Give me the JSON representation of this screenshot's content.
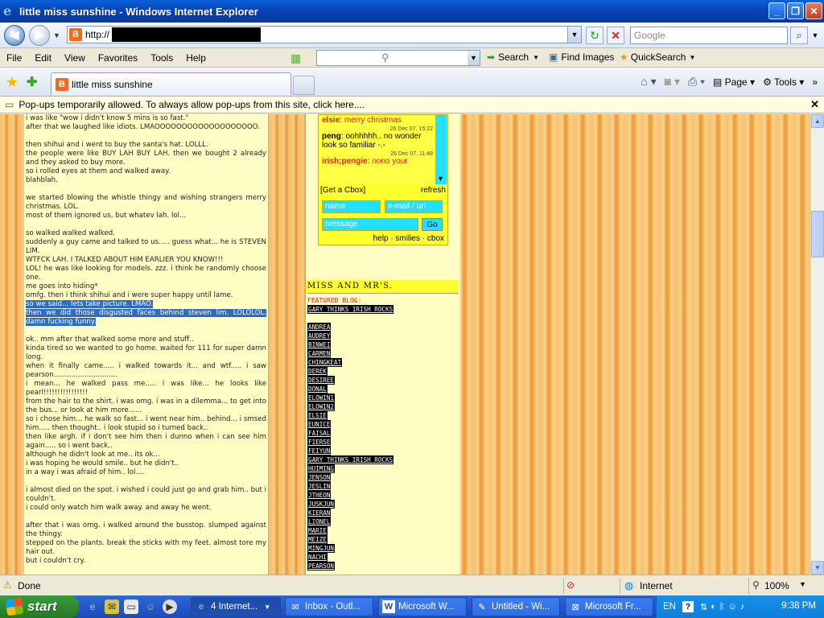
{
  "window": {
    "title": "little miss sunshine - Windows Internet Explorer"
  },
  "address": {
    "url_prefix": "http://",
    "search_placeholder": "Google"
  },
  "menu": {
    "items": [
      "File",
      "Edit",
      "View",
      "Favorites",
      "Tools",
      "Help"
    ],
    "search_label": "Search",
    "find_images_label": "Find Images",
    "quicksearch_label": "QuickSearch"
  },
  "tab": {
    "title": "little miss sunshine",
    "page_label": "Page",
    "tools_label": "Tools"
  },
  "infobar": {
    "text": "Pop-ups temporarily allowed. To always allow pop-ups from this site, click here...."
  },
  "post": {
    "lines": [
      "i was like \"wow i didn't know 5 mins is so fast.\"",
      "after that we laughed like idiots. LMAOOOOOOOOOOOOOOOOOOO.",
      "",
      "then shihui and i went to buy the santa's hat. LOLLL.",
      "the people were like BUY LAH BUY LAH. then we bought 2 already and they asked to buy more.",
      "so i rolled eyes at them and walked away.",
      "blahblah.",
      "",
      "we started blowing the whistle thingy and wishing strangers merry christmas. LOL.",
      "most of them ignored us, but whatev lah. lol...",
      "",
      "so walked walked walked.",
      "suddenly a guy came and talked to us..... guess what... he is STEVEN LIM.",
      "WTFCK LAH. I TALKED ABOUT HIM EARLIER YOU KNOW!!!",
      "LOL! he was like looking for models. zzz. i think he randomly choose one.",
      "me goes into hiding*",
      "omfg. then i think shihui and i were super happy until lame."
    ],
    "highlighted": [
      "so we said... lets take picture. LMAO.",
      "then we did those disgusted faces behind steven lim. LOLOLOL. damn fucking funny."
    ],
    "lines2": [
      "",
      "ok.. mm after that walked some more and stuff..",
      "kinda tired so we wanted to go home. waited for 111 for super damn long.",
      "when it finally came..... i walked towards it... and wtf..... i saw pearson.............................",
      "i mean... he walked pass me..... i was like... he looks like pearl!!!!!!!!!!!!!!!!",
      "from the hair to the shirt. i was omg. i was in a dilemma... to get into the bus... or look at him more......",
      "so i chose him... he walk so fast... i went near him.. behind... i smsed him..... then thought.. i look stupid so i turned back..",
      "then like argh. if i don't see him then i dunno when i can see him again..... so i went back..",
      "although he didn't look at me.. its ok...",
      "i was hoping he would smile.. but he didn't..",
      "in a way i was afraid of him.. lol....",
      "",
      "i almost died on the spot. i wished i could just go and grab him.. but i couldn't.",
      "i could only watch him walk away. and away he went.",
      "",
      "after that i was omg. i walked around the busstop. slumped against the thingy.",
      "stepped on the plants. break the sticks with my feet. almost tore my hair out.",
      "but i couldn't cry."
    ]
  },
  "cbox": {
    "messages": [
      {
        "name": "elsie",
        "text": "merry christmas",
        "ts": ""
      },
      {
        "name": "peng",
        "text": "oohhhhh.. no wonder look so familiar -.-",
        "ts": "26 Dec 07, 15:22"
      },
      {
        "name": "irish;pengie",
        "text": "nono your",
        "ts": "26 Dec 07, 11:48"
      }
    ],
    "get_label": "[Get a Cbox]",
    "refresh_label": "refresh",
    "name_placeholder": "name",
    "email_placeholder": "e-mail / url",
    "message_placeholder": "message",
    "go_label": "Go",
    "footer": "help · smilies · cbox"
  },
  "links": {
    "section_title": "MISS AND MR'S.",
    "featured_label": "FEATURED BLOG:",
    "featured": "GARY THINKS IRISH ROCKS",
    "items": [
      "ANDREA",
      "AUDREY",
      "BINWEI",
      "CARMEN",
      "CHINGKEAT",
      "DEREK",
      "DESIREE",
      "DONAL",
      "ELOWIN1",
      "ELOWIN2",
      "ELSIE",
      "EUNICE",
      "FAISAL",
      "FIERSE",
      "FEIYUN",
      "GARY THINKS IRISH ROCKS",
      "HUIMING",
      "JENSON",
      "JESLIN",
      "JTHEON",
      "JUSKJUN",
      "KIERAN",
      "LIONEL",
      "MARIE",
      "MEIZE",
      "MINGJUN",
      "NACHI",
      "PEARSON"
    ]
  },
  "status": {
    "text": "Done",
    "zone": "Internet",
    "zoom": "100%"
  },
  "taskbar": {
    "start_label": "start",
    "tasks": [
      {
        "label": "4 Internet..."
      },
      {
        "label": "Inbox - Outl..."
      },
      {
        "label": "Microsoft W..."
      },
      {
        "label": "Untitled - Wi..."
      },
      {
        "label": "Microsoft Fr..."
      }
    ],
    "lang": "EN",
    "clock": "9:38 PM"
  }
}
